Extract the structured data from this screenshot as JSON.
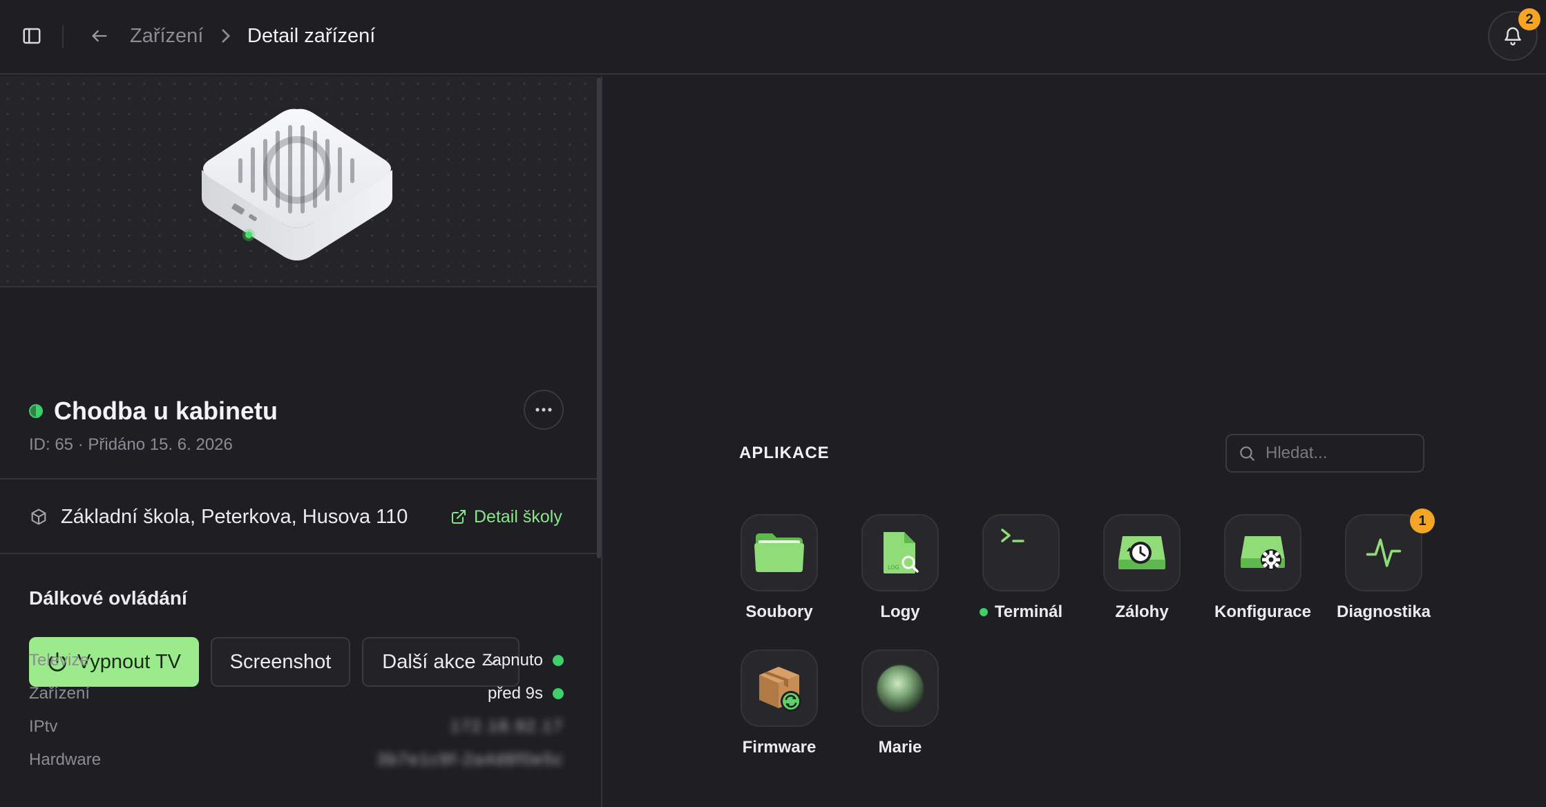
{
  "header": {
    "breadcrumb_parent": "Zařízení",
    "breadcrumb_current": "Detail zařízení",
    "notifications_count": "2"
  },
  "device": {
    "name": "Chodba u kabinetu",
    "meta": "ID: 65 · Přidáno 15. 6. 2026",
    "status_color": "#3ed16a"
  },
  "school": {
    "name": "Základní škola, Peterkova, Husova 110",
    "link_label": "Detail školy"
  },
  "remote": {
    "title": "Dálkové ovládání",
    "power_label": "Vypnout TV",
    "screenshot_label": "Screenshot",
    "more_actions_label": "Další akce"
  },
  "info": [
    {
      "label": "Televize",
      "value": "Zapnuto"
    },
    {
      "label": "Zařízení",
      "value": "před 9s"
    },
    {
      "label": "IPtv",
      "value": "172.18.92.17"
    },
    {
      "label": "Hardware",
      "value": "3b7e1c9f-2a4d8f0e5c"
    }
  ],
  "apps": {
    "title": "APLIKACE",
    "search_placeholder": "Hledat...",
    "items": [
      {
        "label": "Soubory",
        "icon": "folder-icon"
      },
      {
        "label": "Logy",
        "icon": "log-file-icon"
      },
      {
        "label": "Terminál",
        "icon": "terminal-icon",
        "online": true
      },
      {
        "label": "Zálohy",
        "icon": "backup-icon"
      },
      {
        "label": "Konfigurace",
        "icon": "config-icon"
      },
      {
        "label": "Diagnostika",
        "icon": "pulse-icon",
        "badge": "1"
      },
      {
        "label": "Firmware",
        "icon": "firmware-box-icon"
      },
      {
        "label": "Marie",
        "icon": "orb-icon"
      }
    ]
  },
  "colors": {
    "accent_green": "#9beb8c",
    "link_green": "#8ae68a",
    "badge_orange": "#f5a524",
    "background": "#1f1e22"
  }
}
